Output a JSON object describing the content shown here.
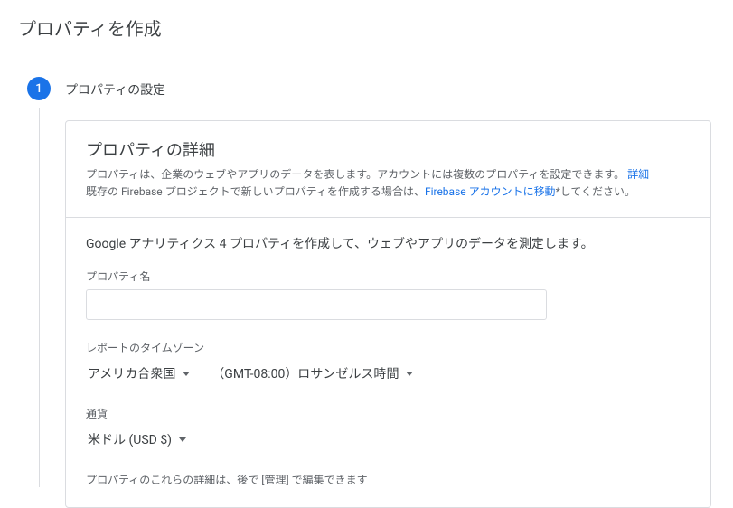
{
  "page": {
    "title": "プロパティを作成"
  },
  "step": {
    "number": "1",
    "title": "プロパティの設定"
  },
  "card": {
    "title": "プロパティの詳細",
    "desc_line1_a": "プロパティは、企業のウェブやアプリのデータを表します。アカウントには複数のプロパティを設定できます。",
    "desc_link1": "詳細",
    "desc_line2_a": "既存の Firebase プロジェクトで新しいプロパティを作成する場合は、",
    "desc_link2": "Firebase アカウントに移動",
    "desc_line2_b": "*してください。"
  },
  "form": {
    "lead": "Google アナリティクス 4 プロパティを作成して、ウェブやアプリのデータを測定します。",
    "name_label": "プロパティ名",
    "name_value": "",
    "timezone_label": "レポートのタイムゾーン",
    "country_value": "アメリカ合衆国",
    "tz_value": "（GMT-08:00）ロサンゼルス時間",
    "currency_label": "通貨",
    "currency_value": "米ドル (USD $)",
    "footnote": "プロパティのこれらの詳細は、後で [管理] で編集できます"
  }
}
